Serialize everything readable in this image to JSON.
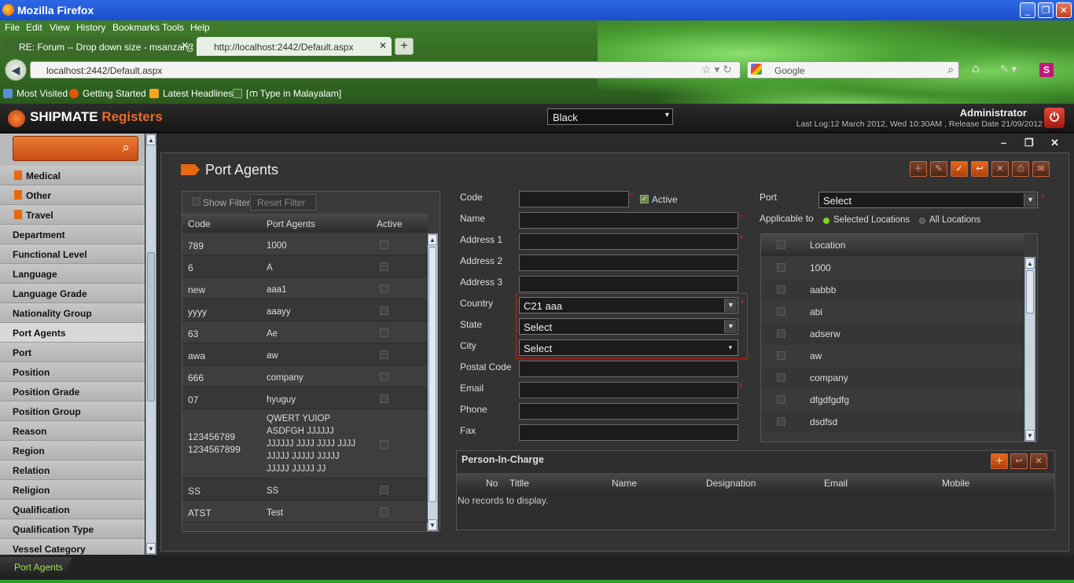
{
  "browser": {
    "title": "Mozilla Firefox",
    "menu": [
      "File",
      "Edit",
      "View",
      "History",
      "Bookmarks",
      "Tools",
      "Help"
    ],
    "tabs": [
      {
        "label": "RE: Forum -- Drop down size - msanzar@..."
      },
      {
        "label": "http://localhost:2442/Default.aspx"
      }
    ],
    "url": "localhost:2442/Default.aspx",
    "search_placeholder": "Google",
    "bookmarks": [
      "Most Visited",
      "Getting Started",
      "Latest Headlines",
      "[ന Type in Malayalam]"
    ]
  },
  "app": {
    "logo_main": "SHIPMATE",
    "logo_sub": "Registers",
    "theme_select": "Black",
    "user": "Administrator",
    "last_log": "Last Log:12 March 2012, Wed 10:30AM , Release Date 21/09/2012"
  },
  "sidebar": {
    "items": [
      {
        "label": "Medical",
        "sub": true
      },
      {
        "label": "Other",
        "sub": true
      },
      {
        "label": "Travel",
        "sub": true
      },
      {
        "label": "Department"
      },
      {
        "label": "Functional Level"
      },
      {
        "label": "Language"
      },
      {
        "label": "Language Grade"
      },
      {
        "label": "Nationality Group"
      },
      {
        "label": "Port Agents",
        "active": true
      },
      {
        "label": "Port"
      },
      {
        "label": "Position"
      },
      {
        "label": "Position Grade"
      },
      {
        "label": "Position Group"
      },
      {
        "label": "Reason"
      },
      {
        "label": "Region"
      },
      {
        "label": "Relation"
      },
      {
        "label": "Religion"
      },
      {
        "label": "Qualification"
      },
      {
        "label": "Qualification Type"
      },
      {
        "label": "Vessel Category"
      }
    ]
  },
  "page": {
    "title": "Port Agents",
    "window_controls": [
      "–",
      "❐",
      "✕"
    ]
  },
  "grid": {
    "show_filter": "Show Filter",
    "reset_filter": "Reset Filter",
    "columns": [
      "Code",
      "Port Agents",
      "Active"
    ],
    "rows": [
      {
        "code": "789",
        "name": "1000"
      },
      {
        "code": "6",
        "name": "A"
      },
      {
        "code": "new",
        "name": "aaa1"
      },
      {
        "code": "yyyy",
        "name": "aaayy"
      },
      {
        "code": "63",
        "name": "Ae"
      },
      {
        "code": "awa",
        "name": "aw"
      },
      {
        "code": "666",
        "name": "company"
      },
      {
        "code": "07",
        "name": "hyuguy"
      },
      {
        "code": "123456789\n1234567899",
        "name": "QWERT YUIOP\nASDFGH JJJJJJ\nJJJJJJ JJJJ JJJJ JJJJ\nJJJJJ JJJJJ JJJJJ\nJJJJJ JJJJJ JJ"
      },
      {
        "code": "SS",
        "name": "SS"
      },
      {
        "code": "ATST",
        "name": "Test"
      }
    ]
  },
  "form": {
    "labels": {
      "code": "Code",
      "active": "Active",
      "name": "Name",
      "address1": "Address 1",
      "address2": "Address 2",
      "address3": "Address 3",
      "country": "Country",
      "state": "State",
      "city": "City",
      "postal": "Postal Code",
      "email": "Email",
      "phone": "Phone",
      "fax": "Fax",
      "port": "Port",
      "applicable": "Applicable to"
    },
    "country_value": "C21 aaa",
    "state_value": "Select",
    "city_value": "Select",
    "port_value": "Select",
    "applicable_options": [
      "Selected Locations",
      "All Locations"
    ],
    "required_mark": "*"
  },
  "locations": {
    "header": "Location",
    "items": [
      "1000",
      "aabbb",
      "abi",
      "adserw",
      "aw",
      "company",
      "dfgdfgdfg",
      "dsdfsd"
    ]
  },
  "person_in_charge": {
    "title": "Person-In-Charge",
    "columns": [
      "No",
      "Titlle",
      "Name",
      "Designation",
      "Email",
      "Mobile"
    ],
    "empty": "No records to display."
  },
  "taskbar": {
    "item": "Port Agents"
  },
  "colors": {
    "accent": "#e8670f",
    "required": "#d01f1f",
    "active_radio": "#7ed321"
  }
}
